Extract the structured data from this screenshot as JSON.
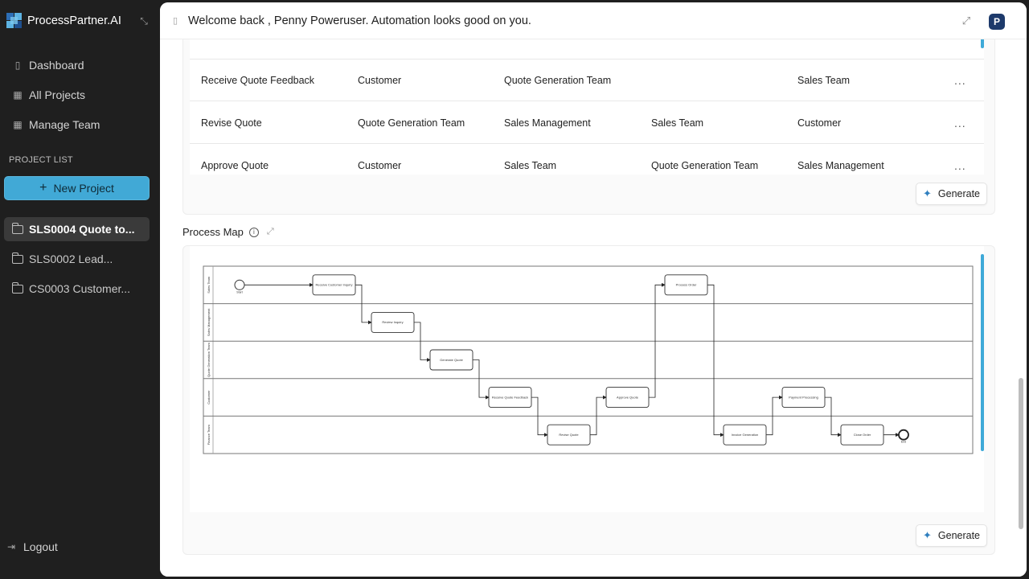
{
  "app": {
    "name": "ProcessPartner.AI"
  },
  "nav": {
    "items": [
      {
        "label": "Dashboard"
      },
      {
        "label": "All Projects"
      },
      {
        "label": "Manage Team"
      }
    ]
  },
  "project_list": {
    "label": "PROJECT LIST",
    "new_button": "New Project",
    "projects": [
      {
        "label": "SLS0004 Quote to...",
        "active": true
      },
      {
        "label": "SLS0002 Lead...",
        "active": false
      },
      {
        "label": "CS0003 Customer...",
        "active": false
      }
    ]
  },
  "logout": "Logout",
  "header": {
    "welcome": "Welcome back , Penny Poweruser. Automation looks good on you.",
    "avatar_initial": "P"
  },
  "raci_table": {
    "rows": [
      {
        "task": "Receive Quote Feedback",
        "c1": "Customer",
        "c2": "Quote Generation Team",
        "c3": "",
        "c4": "Sales Team"
      },
      {
        "task": "Revise Quote",
        "c1": "Quote Generation Team",
        "c2": "Sales Management",
        "c3": "Sales Team",
        "c4": "Customer"
      },
      {
        "task": "Approve Quote",
        "c1": "Customer",
        "c2": "Sales Team",
        "c3": "Quote Generation Team",
        "c4": "Sales Management"
      }
    ],
    "more_label": "...",
    "generate_label": "Generate"
  },
  "process_map": {
    "title": "Process Map",
    "generate_label": "Generate",
    "lanes": [
      "Sales Team",
      "Sales Management",
      "Quote Generation Team",
      "Customer",
      "Finance Team"
    ],
    "tasks": [
      {
        "label": "Receive Customer Inquiry",
        "lane": 0,
        "col": 1
      },
      {
        "label": "Review Inquiry",
        "lane": 1,
        "col": 2
      },
      {
        "label": "Generate Quote",
        "lane": 2,
        "col": 3
      },
      {
        "label": "Receive Quote Feedback",
        "lane": 3,
        "col": 4
      },
      {
        "label": "Revise Quote",
        "lane": 4,
        "col": 5
      },
      {
        "label": "Approve Quote",
        "lane": 3,
        "col": 6
      },
      {
        "label": "Process Order",
        "lane": 0,
        "col": 7
      },
      {
        "label": "Invoice Generation",
        "lane": 4,
        "col": 8
      },
      {
        "label": "Payment Processing",
        "lane": 3,
        "col": 9
      },
      {
        "label": "Close Order",
        "lane": 4,
        "col": 10
      }
    ],
    "start_label": "Start",
    "end_label": "End"
  },
  "colors": {
    "accent": "#41a9d6",
    "sidebar_bg": "#1f1f1f",
    "avatar_bg": "#1d3a6b"
  }
}
